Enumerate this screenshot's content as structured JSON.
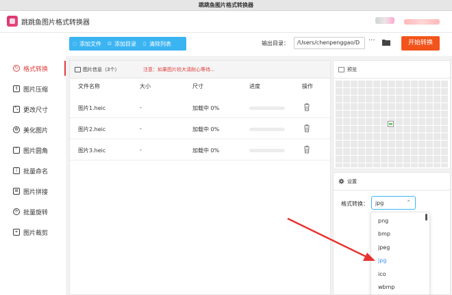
{
  "window": {
    "title": "跳跳鱼图片格式转换器"
  },
  "app": {
    "name": "跳跳鱼图片格式转换器"
  },
  "toolbar": {
    "add_file": "添加文件",
    "add_dir": "添加目录",
    "clear_list": "清除列表",
    "output_label": "输出目录：",
    "output_path": "/Users/chenpenggao/D",
    "more": "···",
    "start": "开始转换"
  },
  "sidebar": {
    "items": [
      {
        "label": "格式转换",
        "icon": "format-convert-icon",
        "active": true
      },
      {
        "label": "图片压缩",
        "icon": "compress-icon"
      },
      {
        "label": "更改尺寸",
        "icon": "resize-icon"
      },
      {
        "label": "美化图片",
        "icon": "beautify-icon"
      },
      {
        "label": "图片圆角",
        "icon": "round-corner-icon"
      },
      {
        "label": "批量命名",
        "icon": "batch-rename-icon"
      },
      {
        "label": "图片拼接",
        "icon": "stitch-icon"
      },
      {
        "label": "批量旋转",
        "icon": "rotate-icon"
      },
      {
        "label": "图片裁剪",
        "icon": "crop-icon"
      }
    ]
  },
  "file_panel": {
    "info_label": "图片信息（3个）",
    "notice": "注意：如果图片较大请耐心等待...",
    "columns": [
      "文件名称",
      "大小",
      "尺寸",
      "进度",
      "操作"
    ],
    "rows": [
      {
        "name": "图片1.heic",
        "size": "-",
        "dims": "加载中 0%",
        "progress": 0
      },
      {
        "name": "图片2.heic",
        "size": "-",
        "dims": "加载中 0%",
        "progress": 0
      },
      {
        "name": "图片3.heic",
        "size": "-",
        "dims": "加载中 0%",
        "progress": 0
      }
    ]
  },
  "preview": {
    "label": "预览"
  },
  "settings": {
    "label": "设置",
    "format_label": "格式转换：",
    "format_value": "jpg",
    "options": [
      "png",
      "bmp",
      "jpeg",
      "jpg",
      "ico",
      "wbmp"
    ]
  },
  "colors": {
    "accent_blue": "#3bb4f2",
    "start_orange": "#f2541b",
    "active_red": "#e23c3c",
    "arrow_red": "#e8322f"
  }
}
